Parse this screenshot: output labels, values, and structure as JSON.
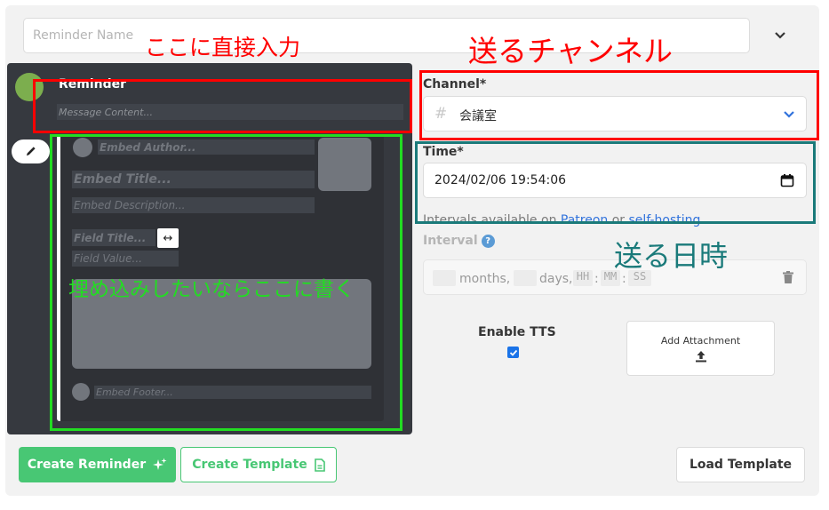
{
  "reminder_name": {
    "placeholder": "Reminder Name"
  },
  "editor": {
    "username": "Reminder",
    "message_placeholder": "Message Content...",
    "embed": {
      "author_placeholder": "Embed Author...",
      "title_placeholder": "Embed Title...",
      "description_placeholder": "Embed Description...",
      "field_title_placeholder": "Field Title...",
      "field_value_placeholder": "Field Value...",
      "inline_toggle": "↔",
      "footer_placeholder": "Embed Footer..."
    }
  },
  "channel": {
    "label": "Channel*",
    "hash": "#",
    "value": "会議室"
  },
  "time": {
    "label": "Time*",
    "value": "2024/02/06 19:54:06",
    "hint_prefix": "Intervals available on ",
    "hint_link1": "Patreon",
    "hint_mid": " or ",
    "hint_link2": "self-hosting"
  },
  "interval": {
    "label": "Interval",
    "help": "?",
    "months_label": "months,",
    "days_label": "days,",
    "hh": "HH",
    "mm": "MM",
    "ss": "SS",
    "sep": ":"
  },
  "tts": {
    "label": "Enable TTS",
    "checked": true
  },
  "attachment": {
    "label": "Add Attachment"
  },
  "buttons": {
    "create_reminder": "Create Reminder",
    "create_template": "Create Template",
    "load_template": "Load Template"
  },
  "annotations": {
    "direct_input": "ここに直接入力",
    "channel_to_send": "送るチャンネル",
    "send_datetime": "送る日時",
    "embed_note": "埋め込みしたいならここに書く"
  },
  "colors": {
    "accent_green": "#48c774",
    "link_blue": "#3273dc",
    "annot_red": "#ff0000",
    "annot_green": "#22dd22",
    "annot_teal": "#1a7a7a",
    "embed_bg": "#2f3136",
    "editor_bg": "#36393f"
  }
}
